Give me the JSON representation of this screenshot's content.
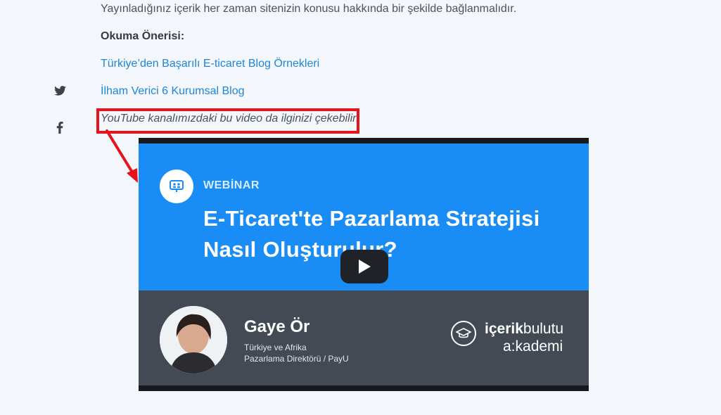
{
  "article": {
    "intro_text": "Yayınladığınız içerik her zaman sitenizin konusu hakkında bir şekilde bağlanmalıdır.",
    "reading_suggestion_label": "Okuma Önerisi:",
    "links": [
      "Türkiye’den Başarılı E-ticaret Blog Örnekleri",
      "İlham Verici 6 Kurumsal Blog"
    ],
    "video_intro": "YouTube kanalımızdaki bu video da ilginizi çekebilir."
  },
  "share": {
    "icons": [
      "twitter-icon",
      "facebook-icon"
    ]
  },
  "video": {
    "badge": "WEBİNAR",
    "title": "E-Ticaret'te Pazarlama Stratejisi Nasıl Oluşturulur?",
    "speaker_name": "Gaye Ör",
    "speaker_role_line1": "Türkiye ve Afrika",
    "speaker_role_line2": "Pazarlama Direktörü / PayU",
    "brand_bold": "içerik",
    "brand_regular": "bulutu",
    "brand_line2": "a:kademi"
  },
  "colors": {
    "annotation": "#e6131a",
    "link": "#1f86d6",
    "video_blue": "#1a8cf5",
    "video_dark": "#434a54"
  }
}
